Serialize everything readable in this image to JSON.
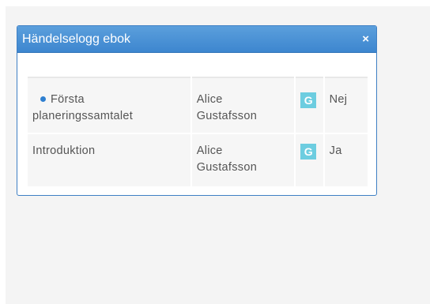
{
  "dialog": {
    "title": "Händelselogg ebok",
    "close_label": "×"
  },
  "rows": [
    {
      "name_line1": "Första",
      "name_line2": "planeringssamtalet",
      "user_line1": "Alice",
      "user_line2": "Gustafsson",
      "grade": "G",
      "answer": "Nej",
      "has_dot": true
    },
    {
      "name_line1": "Introduktion",
      "name_line2": "",
      "user_line1": "Alice",
      "user_line2": "Gustafsson",
      "grade": "G",
      "answer": "Ja",
      "has_dot": false
    }
  ],
  "colors": {
    "titlebar": "#4a93d6",
    "badge": "#6dcde0",
    "dot": "#2e7fd0",
    "row_bg": "#f6f6f6"
  }
}
